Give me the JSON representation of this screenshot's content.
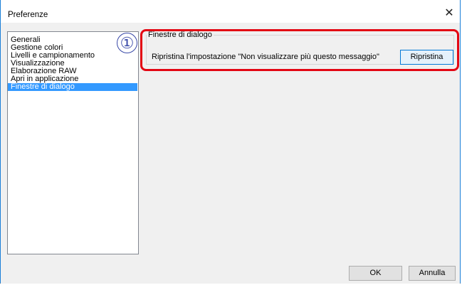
{
  "window": {
    "title": "Preferenze",
    "close_glyph": "✕"
  },
  "category_list": {
    "items": [
      {
        "label": "Generali",
        "selected": false
      },
      {
        "label": "Gestione colori",
        "selected": false
      },
      {
        "label": "Livelli e campionamento",
        "selected": false
      },
      {
        "label": "Visualizzazione",
        "selected": false
      },
      {
        "label": "Elaborazione RAW",
        "selected": false
      },
      {
        "label": "Apri in applicazione",
        "selected": false
      },
      {
        "label": "Finestre di dialogo",
        "selected": true
      }
    ]
  },
  "callout": {
    "marker": "①"
  },
  "dialog_group": {
    "title": "Finestre di dialogo",
    "description": "Ripristina l'impostazione \"Non visualizzare più questo messaggio\"",
    "reset_button_label": "Ripristina"
  },
  "footer": {
    "ok_label": "OK",
    "cancel_label": "Annulla"
  },
  "colors": {
    "selection": "#3399ff",
    "highlight": "#e30613",
    "window_border": "#1a7fd8",
    "callout": "#3a4aa8"
  }
}
